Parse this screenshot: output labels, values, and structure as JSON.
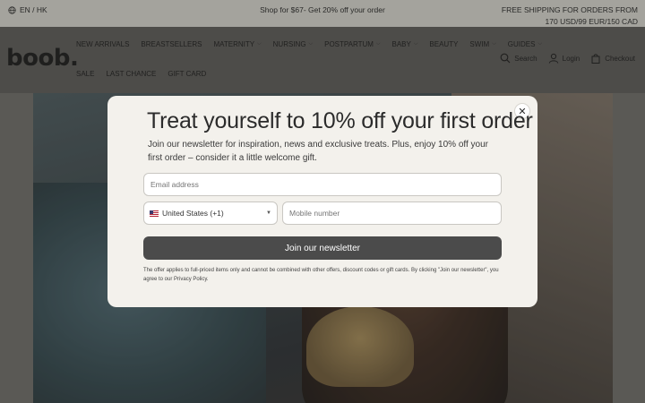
{
  "topbar": {
    "lang": "EN / HK",
    "lang_icon": "globe-icon",
    "promo": "Shop for $67- Get 20% off your order",
    "shipping_line1": "FREE SHIPPING FOR ORDERS FROM",
    "shipping_line2": "170 USD/99 EUR/150 CAD"
  },
  "header": {
    "logo": "boob.",
    "nav_row1": [
      {
        "label": "NEW ARRIVALS",
        "has_dropdown": false
      },
      {
        "label": "BREASTSELLERS",
        "has_dropdown": false
      },
      {
        "label": "MATERNITY",
        "has_dropdown": true
      },
      {
        "label": "NURSING",
        "has_dropdown": true
      },
      {
        "label": "POSTPARTUM",
        "has_dropdown": true
      },
      {
        "label": "BABY",
        "has_dropdown": true
      },
      {
        "label": "BEAUTY",
        "has_dropdown": false
      },
      {
        "label": "SWIM",
        "has_dropdown": true
      },
      {
        "label": "GUIDES",
        "has_dropdown": true
      }
    ],
    "nav_row2": [
      {
        "label": "SALE"
      },
      {
        "label": "LAST CHANCE"
      },
      {
        "label": "GIFT CARD"
      }
    ],
    "actions": {
      "search": "Search",
      "login": "Login",
      "checkout": "Checkout"
    },
    "chevron_glyph": "⌵"
  },
  "modal": {
    "close_glyph": "✕",
    "title": "Treat yourself to 10% off your first order",
    "description": "Join our newsletter for inspiration, news and exclusive treats. Plus, enjoy 10% off your first order – consider it a little welcome gift.",
    "email_placeholder": "Email address",
    "country_value": "United States (+1)",
    "country_arrow": "▼",
    "mobile_placeholder": "Mobile number",
    "submit_label": "Join our newsletter",
    "disclaimer": "The offer applies to full-priced items only and cannot be combined with other offers, discount codes or gift cards. By clicking \"Join our newsletter\", you agree to our Privacy Policy."
  },
  "colors": {
    "topbar_bg": "#d4d3cc",
    "modal_bg": "#f3f1ec",
    "button_bg": "#4b4b4b"
  }
}
